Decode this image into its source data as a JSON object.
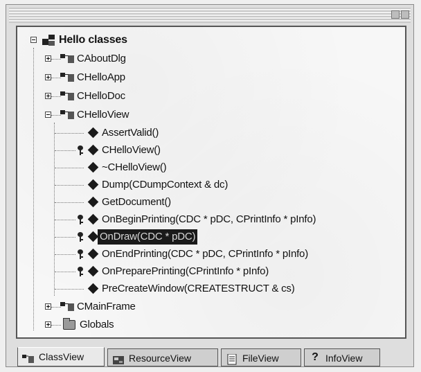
{
  "tree": {
    "root": {
      "label": "Hello classes"
    },
    "classes": [
      {
        "label": "CAboutDlg"
      },
      {
        "label": "CHelloApp"
      },
      {
        "label": "CHelloDoc"
      },
      {
        "label": "CHelloView"
      }
    ],
    "members": [
      {
        "label": "AssertValid()"
      },
      {
        "label": "CHelloView()"
      },
      {
        "label": "~CHelloView()"
      },
      {
        "label": "Dump(CDumpContext & dc)"
      },
      {
        "label": "GetDocument()"
      },
      {
        "label": "OnBeginPrinting(CDC * pDC, CPrintInfo * pInfo)"
      },
      {
        "label": "OnDraw(CDC * pDC)"
      },
      {
        "label": "OnEndPrinting(CDC * pDC, CPrintInfo * pInfo)"
      },
      {
        "label": "OnPreparePrinting(CPrintInfo * pInfo)"
      },
      {
        "label": "PreCreateWindow(CREATESTRUCT & cs)"
      }
    ],
    "after": [
      {
        "label": "CMainFrame"
      },
      {
        "label": "Globals"
      }
    ],
    "selected": "OnDraw(CDC * pDC)"
  },
  "tabs": [
    {
      "label": "ClassView",
      "icon": "class-icon",
      "active": true
    },
    {
      "label": "ResourceView",
      "icon": "resource-icon",
      "active": false
    },
    {
      "label": "FileView",
      "icon": "file-icon",
      "active": false
    },
    {
      "label": "InfoView",
      "icon": "help-icon",
      "active": false
    }
  ]
}
